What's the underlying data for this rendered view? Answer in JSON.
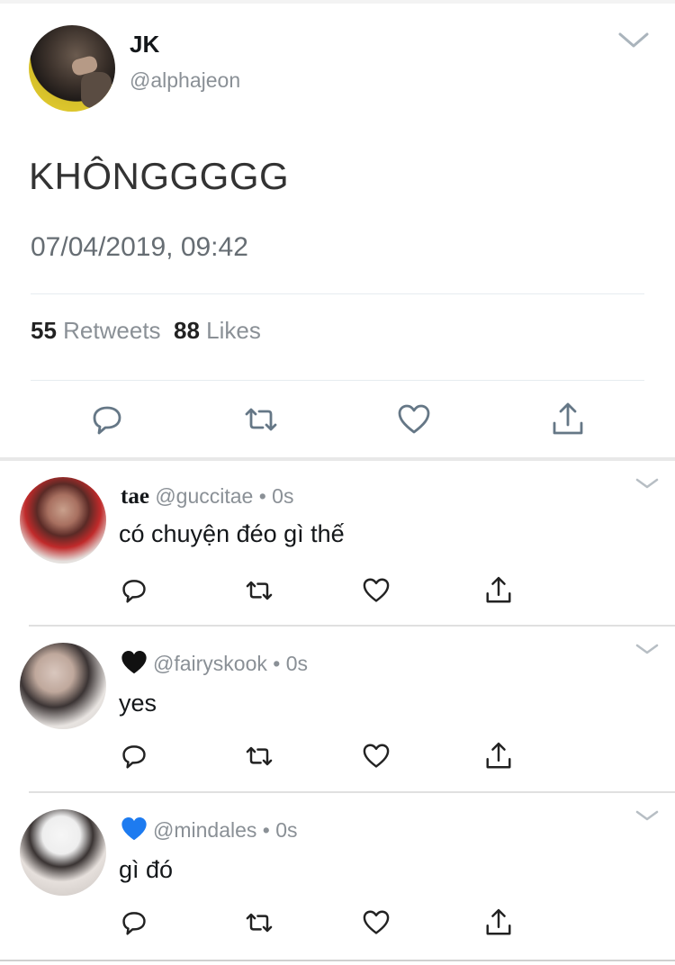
{
  "main_tweet": {
    "display_name": "JK",
    "handle": "@alphajeon",
    "text": "KHÔNGGGGG",
    "timestamp": "07/04/2019, 09:42",
    "retweets_count": "55",
    "retweets_label": "Retweets",
    "likes_count": "88",
    "likes_label": "Likes",
    "actions": [
      "reply-icon",
      "retweet-icon",
      "like-icon",
      "share-icon"
    ]
  },
  "replies": [
    {
      "name": "tae",
      "handle": "@guccitae",
      "separator": "•",
      "time": "0s",
      "text": "có chuyện đéo gì thế"
    },
    {
      "name_icon": "black-heart-icon",
      "handle": "@fairyskook",
      "separator": "•",
      "time": "0s",
      "text": "yes"
    },
    {
      "name_icon": "blue-heart-icon",
      "handle": "@mindales",
      "separator": "•",
      "time": "0s",
      "text": "gì đó"
    }
  ],
  "colors": {
    "text": "#14171a",
    "muted": "#8a9096",
    "divider": "#e6ecf0",
    "blue_heart": "#1d7bf0"
  }
}
